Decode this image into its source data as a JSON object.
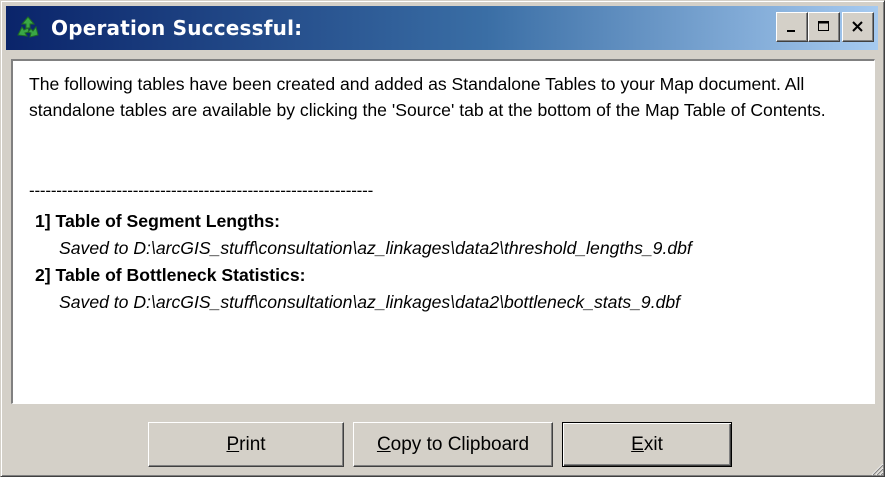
{
  "window": {
    "title": "Operation Successful:",
    "controls": {
      "minimize_label": "_",
      "maximize_label": "□",
      "close_label": "×"
    }
  },
  "message": {
    "intro": "The following tables have been created and added as Standalone Tables to your Map document.  All standalone tables are available by clicking the 'Source' tab at the bottom of the Map Table of Contents.",
    "divider": "---------------------------------------------------------------",
    "items": [
      {
        "heading": "1] Table of Segment Lengths:",
        "path": "Saved to D:\\arcGIS_stuff\\consultation\\az_linkages\\data2\\threshold_lengths_9.dbf"
      },
      {
        "heading": "2] Table of Bottleneck Statistics:",
        "path": "Saved to D:\\arcGIS_stuff\\consultation\\az_linkages\\data2\\bottleneck_stats_9.dbf"
      }
    ]
  },
  "buttons": {
    "print": {
      "mnemonic": "P",
      "rest": "rint"
    },
    "copy": {
      "mnemonic": "C",
      "rest": "opy to Clipboard"
    },
    "exit": {
      "mnemonic": "E",
      "rest": "xit"
    }
  },
  "colors": {
    "titlebar_start": "#0a246a",
    "titlebar_end": "#a6caf0",
    "face": "#d4d0c8",
    "icon_green": "#2e8b3a"
  },
  "icons": {
    "app": "green-recycle-arrows-icon",
    "resize": "size-grip-icon"
  }
}
